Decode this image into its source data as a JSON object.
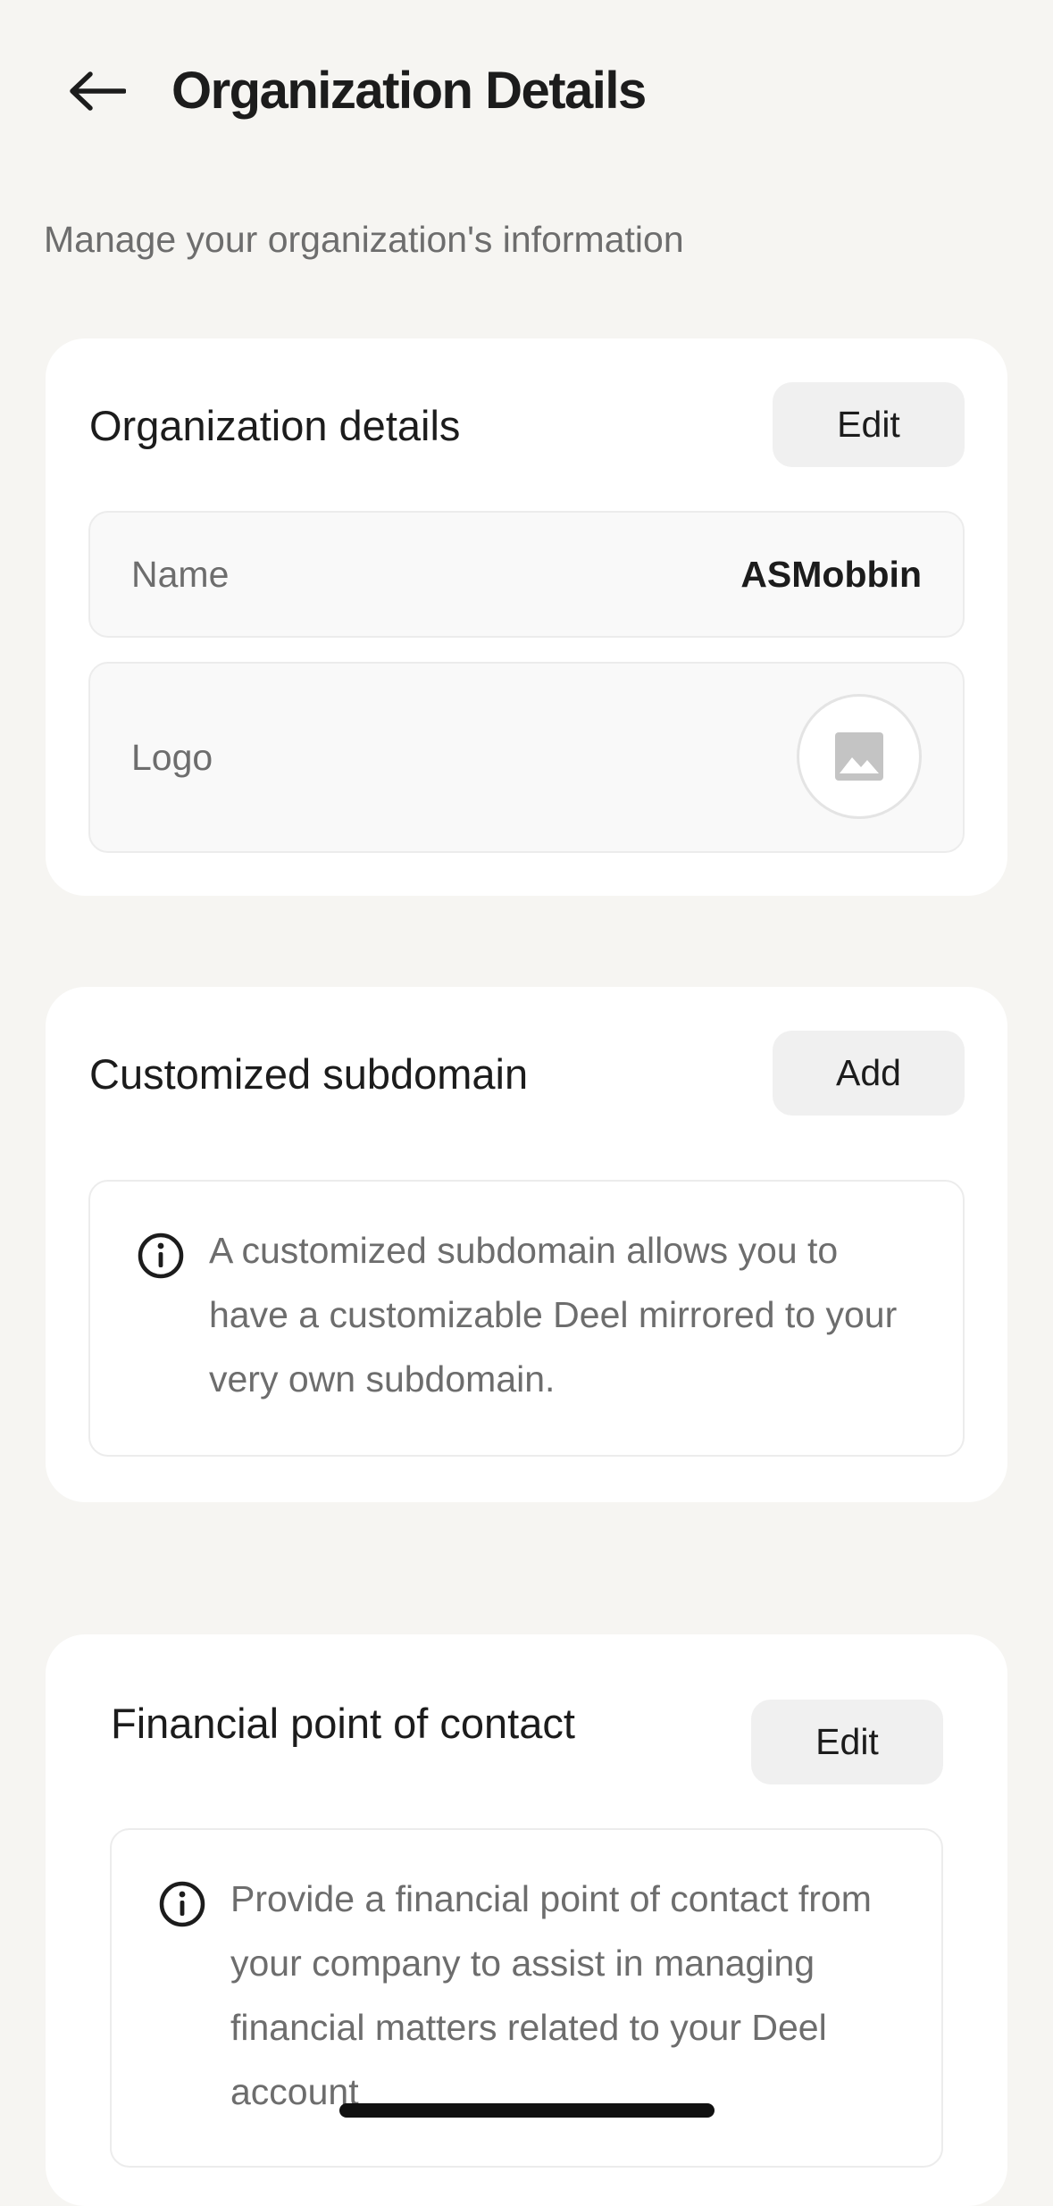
{
  "header": {
    "back_icon": "arrow-left-icon",
    "title": "Organization Details"
  },
  "subtitle": "Manage your organization's information",
  "org_card": {
    "title": "Organization details",
    "edit_label": "Edit",
    "name_label": "Name",
    "name_value": "ASMobbin",
    "logo_label": "Logo",
    "logo_icon": "image-placeholder-icon"
  },
  "subdomain_card": {
    "title": "Customized subdomain",
    "add_label": "Add",
    "info_icon": "info-icon",
    "info_text": "A customized subdomain allows you to have a customizable Deel mirrored to your very own subdomain."
  },
  "finance_card": {
    "title": "Financial point of contact",
    "edit_label": "Edit",
    "info_icon": "info-icon",
    "info_text": "Provide a financial point of contact from your company to assist in managing financial matters related to your Deel account"
  },
  "colors": {
    "background": "#f6f5f2",
    "card": "#ffffff",
    "button": "#f0f0f0",
    "text_primary": "#1c1c1c",
    "text_secondary": "#6d6d6d"
  }
}
